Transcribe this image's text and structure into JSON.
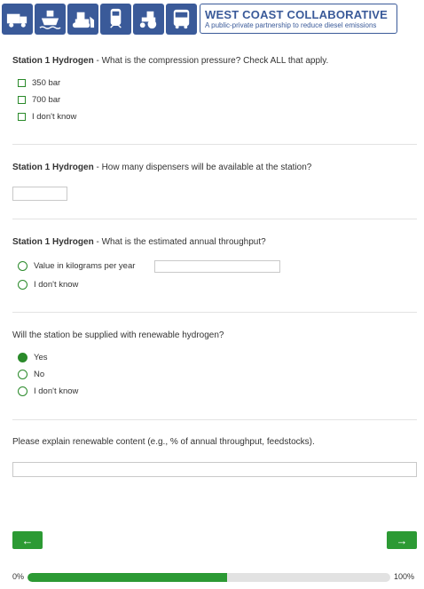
{
  "header": {
    "icons": [
      "truck-icon",
      "ship-icon",
      "bulldozer-icon",
      "locomotive-icon",
      "tractor-icon",
      "bus-icon"
    ],
    "brand_title": "WEST COAST COLLABORATIVE",
    "brand_tagline": "A public-private partnership to reduce diesel emissions"
  },
  "q1": {
    "prefix": "Station 1 Hydrogen",
    "text": " - What is the compression pressure? Check ALL that apply.",
    "options": [
      "350 bar",
      "700 bar",
      "I don't know"
    ]
  },
  "q2": {
    "prefix": "Station 1 Hydrogen",
    "text": " - How many dispensers will be available at the station?",
    "value": ""
  },
  "q3": {
    "prefix": "Station 1 Hydrogen",
    "text": " - What is the estimated annual throughput?",
    "options": [
      "Value in kilograms per year",
      "I don't know"
    ],
    "value": ""
  },
  "q4": {
    "text": "Will the station be supplied with renewable hydrogen?",
    "options": [
      "Yes",
      "No",
      "I don't know"
    ],
    "selected": "Yes"
  },
  "q5": {
    "text": "Please explain renewable content (e.g., % of annual throughput, feedstocks).",
    "value": ""
  },
  "nav": {
    "back_label": "←",
    "next_label": "→"
  },
  "progress": {
    "start_label": "0%",
    "end_label": "100%",
    "percent": 55
  },
  "colors": {
    "brand": "#3a5a99",
    "accent": "#2c9a34",
    "track": "#e2e2e2"
  }
}
